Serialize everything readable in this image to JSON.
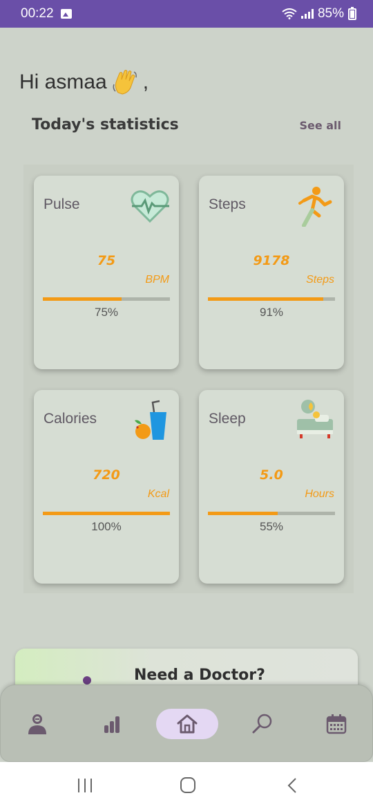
{
  "status_bar": {
    "time": "00:22",
    "battery": "85%"
  },
  "greeting": {
    "text": "Hi asmaa",
    "suffix": ","
  },
  "stats": {
    "title": "Today's statistics",
    "see_all": "See all"
  },
  "cards": [
    {
      "label": "Pulse",
      "value": "75",
      "unit": "BPM",
      "percent_text": "75%",
      "progress": 0.62,
      "icon": "heart-pulse-icon"
    },
    {
      "label": "Steps",
      "value": "9178",
      "unit": "Steps",
      "percent_text": "91%",
      "progress": 0.91,
      "icon": "running-person-icon"
    },
    {
      "label": "Calories",
      "value": "720",
      "unit": "Kcal",
      "percent_text": "100%",
      "progress": 1.0,
      "icon": "juice-orange-icon"
    },
    {
      "label": "Sleep",
      "value": "5.0",
      "unit": "Hours",
      "percent_text": "55%",
      "progress": 0.55,
      "icon": "bed-moon-icon"
    }
  ],
  "doctor": {
    "title": "Need a Doctor?"
  },
  "nav": [
    {
      "name": "profile",
      "icon": "person-icon",
      "active": false
    },
    {
      "name": "stats",
      "icon": "bar-chart-icon",
      "active": false
    },
    {
      "name": "home",
      "icon": "home-icon",
      "active": true
    },
    {
      "name": "search",
      "icon": "search-icon",
      "active": false
    },
    {
      "name": "calendar",
      "icon": "calendar-icon",
      "active": false
    }
  ],
  "colors": {
    "accent": "#f39a16",
    "status_bar": "#6a4fa8",
    "nav_active": "#e4d8f3",
    "icon": "#6b5a6e"
  }
}
